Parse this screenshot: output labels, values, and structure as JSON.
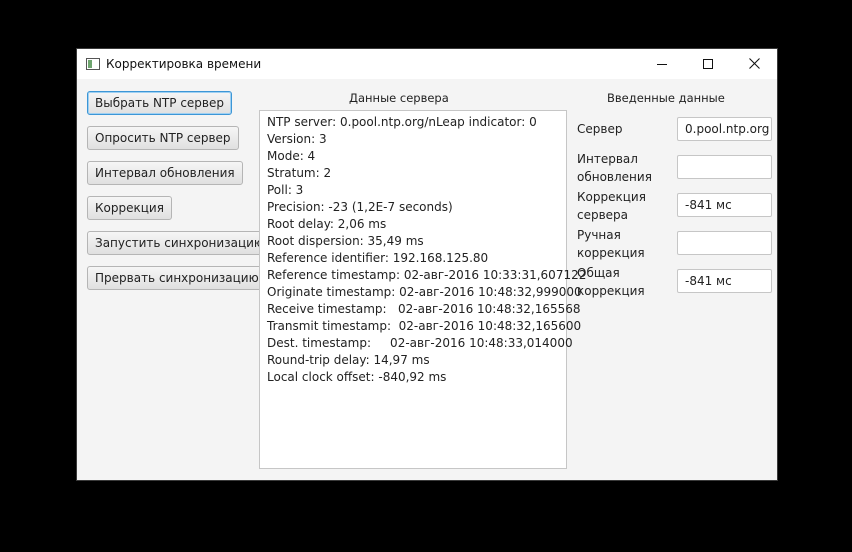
{
  "window": {
    "title": "Корректировка времени"
  },
  "buttons": {
    "choose_server": "Выбрать NTP сервер",
    "poll_server": "Опросить NTP сервер",
    "update_interval": "Интервал обновления",
    "correction": "Коррекция",
    "start_sync": "Запустить синхронизацию",
    "stop_sync": "Прервать синхронизацию"
  },
  "server_panel": {
    "title": "Данные сервера",
    "lines": [
      "NTP server: 0.pool.ntp.org/nLeap indicator: 0",
      "Version: 3",
      "Mode: 4",
      "Stratum: 2",
      "Poll: 3",
      "Precision: -23 (1,2E-7 seconds)",
      "Root delay: 2,06 ms",
      "Root dispersion: 35,49 ms",
      "Reference identifier: 192.168.125.80",
      "Reference timestamp: 02-авг-2016 10:33:31,607122",
      "Originate timestamp: 02-авг-2016 10:48:32,999000",
      "Receive timestamp:   02-авг-2016 10:48:32,165568",
      "Transmit timestamp:  02-авг-2016 10:48:32,165600",
      "Dest. timestamp:     02-авг-2016 10:48:33,014000",
      "Round-trip delay: 14,97 ms",
      "Local clock offset: -840,92 ms"
    ]
  },
  "input_panel": {
    "title": "Введенные данные",
    "fields": {
      "server": {
        "label": "Сервер",
        "value": "0.pool.ntp.org"
      },
      "interval": {
        "label_1": "Интервал",
        "label_2": "обновления",
        "value": ""
      },
      "server_correction": {
        "label_1": "Коррекция",
        "label_2": "сервера",
        "value": "-841 мс"
      },
      "manual_correction": {
        "label_1": "Ручная",
        "label_2": "коррекция",
        "value": ""
      },
      "total_correction": {
        "label_1": "Общая",
        "label_2": "коррекция",
        "value": "-841 мс"
      }
    }
  }
}
